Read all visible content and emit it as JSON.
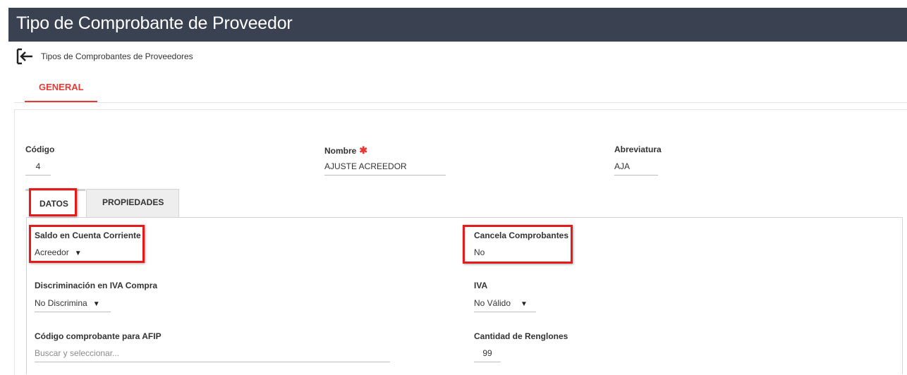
{
  "header": {
    "title": "Tipo de Comprobante de Proveedor"
  },
  "breadcrumb": {
    "back_icon": "back-arrow-icon",
    "label": "Tipos de Comprobantes de Proveedores"
  },
  "tabs": {
    "general": "GENERAL"
  },
  "fields": {
    "codigo": {
      "label": "Código",
      "value": "4"
    },
    "nombre": {
      "label": "Nombre",
      "required_mark": "✱",
      "value": "AJUSTE ACREEDOR"
    },
    "abreviatura": {
      "label": "Abreviatura",
      "value": "AJA"
    }
  },
  "subtabs": {
    "datos": "DATOS",
    "propiedades": "PROPIEDADES"
  },
  "datos": {
    "saldo": {
      "label": "Saldo en Cuenta Corriente",
      "value": "Acreedor"
    },
    "cancela": {
      "label": "Cancela Comprobantes",
      "value": "No"
    },
    "discriminacion": {
      "label": "Discriminación en IVA Compra",
      "value": "No Discrimina"
    },
    "iva": {
      "label": "IVA",
      "value": "No Válido"
    },
    "afip": {
      "label": "Código comprobante para AFIP",
      "placeholder": "Buscar y seleccionar..."
    },
    "renglones": {
      "label": "Cantidad de Renglones",
      "value": "99"
    }
  },
  "caret_glyph": "▼",
  "colors": {
    "header_bg": "#3a4150",
    "accent": "#e53935",
    "highlight": "#e31b1b"
  }
}
